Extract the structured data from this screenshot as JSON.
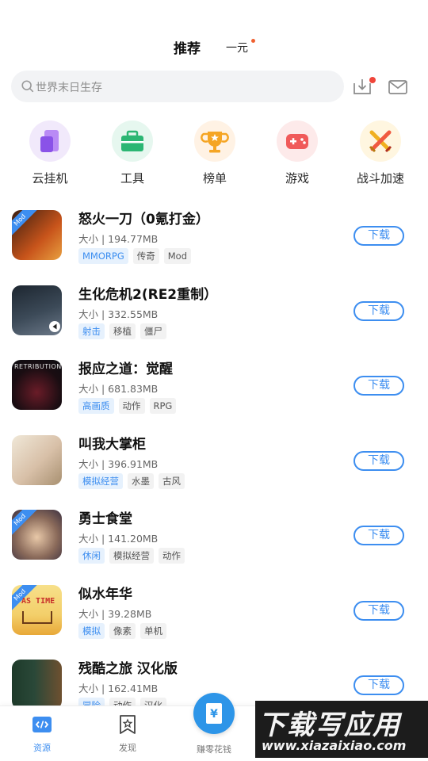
{
  "top_tabs": {
    "active": "推荐",
    "second": "一元"
  },
  "search": {
    "placeholder": "世界末日生存"
  },
  "categories": [
    {
      "label": "云挂机",
      "icon": "phone-icon",
      "bg": "#f1e9fb",
      "fg": "#a46ef0"
    },
    {
      "label": "工具",
      "icon": "toolbox-icon",
      "bg": "#e6f7ef",
      "fg": "#2bb673"
    },
    {
      "label": "榜单",
      "icon": "trophy-icon",
      "bg": "#fff2e4",
      "fg": "#f5a524"
    },
    {
      "label": "游戏",
      "icon": "gamepad-icon",
      "bg": "#fdeaea",
      "fg": "#f05a5a"
    },
    {
      "label": "战斗加速",
      "icon": "swords-icon",
      "bg": "#fff6e0",
      "fg": "#f0b020"
    }
  ],
  "apps": [
    {
      "title": "怒火一刀（0氪打金）",
      "size": "大小 | 194.77MB",
      "tags": [
        "MMORPG",
        "传奇",
        "Mod"
      ],
      "mod": true,
      "thumb": [
        "#3a1e10",
        "#c8541b"
      ],
      "download": "下载"
    },
    {
      "title": "生化危机2(RE2重制）",
      "size": "大小 | 332.55MB",
      "tags": [
        "射击",
        "移植",
        "僵尸"
      ],
      "mod": false,
      "thumb": [
        "#1d2630",
        "#6b7888"
      ],
      "download": "下载"
    },
    {
      "title": "报应之道：觉醒",
      "size": "大小 | 681.83MB",
      "tags": [
        "高画质",
        "动作",
        "RPG"
      ],
      "mod": false,
      "thumb": [
        "#0d0d12",
        "#4a1620"
      ],
      "banner": "RETRIBUTION",
      "download": "下载"
    },
    {
      "title": "叫我大掌柜",
      "size": "大小 | 396.91MB",
      "tags": [
        "模拟经营",
        "水墨",
        "古风"
      ],
      "mod": false,
      "thumb": [
        "#e8ddc8",
        "#c8a890"
      ],
      "download": "下载"
    },
    {
      "title": "勇士食堂",
      "size": "大小 | 141.20MB",
      "tags": [
        "休闲",
        "模拟经营",
        "动作"
      ],
      "mod": true,
      "thumb": [
        "#3b3040",
        "#d8b090"
      ],
      "download": "下载"
    },
    {
      "title": "似水年华",
      "size": "大小 | 39.28MB",
      "tags": [
        "模拟",
        "像素",
        "单机"
      ],
      "mod": true,
      "thumb": [
        "#f3d57a",
        "#f0a830"
      ],
      "banner": "AS TIME",
      "download": "下载"
    },
    {
      "title": "残酷之旅  汉化版",
      "size": "大小 | 162.41MB",
      "tags": [
        "冒险",
        "动作",
        "汉化"
      ],
      "mod": false,
      "thumb": [
        "#1e3a2a",
        "#6e5030"
      ],
      "download": "下载"
    }
  ],
  "bottom_nav": [
    {
      "label": "资源",
      "icon": "code-icon",
      "active": true
    },
    {
      "label": "发现",
      "icon": "star-bookmark-icon",
      "active": false
    },
    {
      "label": "赚零花钱",
      "icon": "money-icon",
      "active": false
    }
  ],
  "watermark": {
    "title": "下载写应用",
    "url": "www.xiazaixiao.com"
  },
  "colors": {
    "accent": "#3d8ef0",
    "badge": "#f0453a"
  }
}
